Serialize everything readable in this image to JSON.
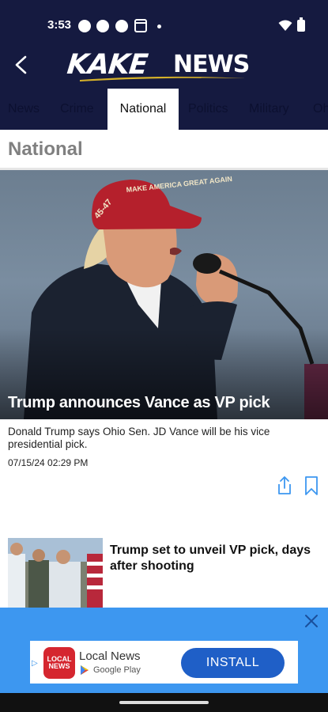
{
  "status_bar": {
    "time": "3:53"
  },
  "header": {
    "logo_main": "KAKE",
    "logo_sub": "NEWS",
    "colors": {
      "background": "#151a40",
      "swoosh": "#d4b02a"
    }
  },
  "tabs": [
    {
      "label": "News"
    },
    {
      "label": "Crime"
    },
    {
      "label": "National",
      "active": true
    },
    {
      "label": "Politics"
    },
    {
      "label": "Military"
    },
    {
      "label": "Oh"
    }
  ],
  "section": {
    "title": "National"
  },
  "featured": {
    "headline": "Trump announces Vance as VP pick",
    "summary": "Donald Trump says Ohio Sen. JD Vance will be his vice presidential pick.",
    "timestamp": "07/15/24 02:29 PM",
    "cap_text": "MAKE AMERICA GREAT AGAIN",
    "cap_side": "45-47"
  },
  "stories": [
    {
      "headline": "Trump set to unveil VP pick, days after shooting"
    }
  ],
  "ad": {
    "icon_text_line1": "LOCAL",
    "icon_text_line2": "NEWS",
    "app_name": "Local News",
    "store": "Google Play",
    "install_label": "INSTALL",
    "colors": {
      "banner": "#3d97f0",
      "button": "#1f5fc7"
    }
  },
  "icons": [
    "back-icon",
    "share-icon",
    "bookmark-icon",
    "close-icon",
    "wifi-icon",
    "battery-icon",
    "google-play-icon"
  ]
}
